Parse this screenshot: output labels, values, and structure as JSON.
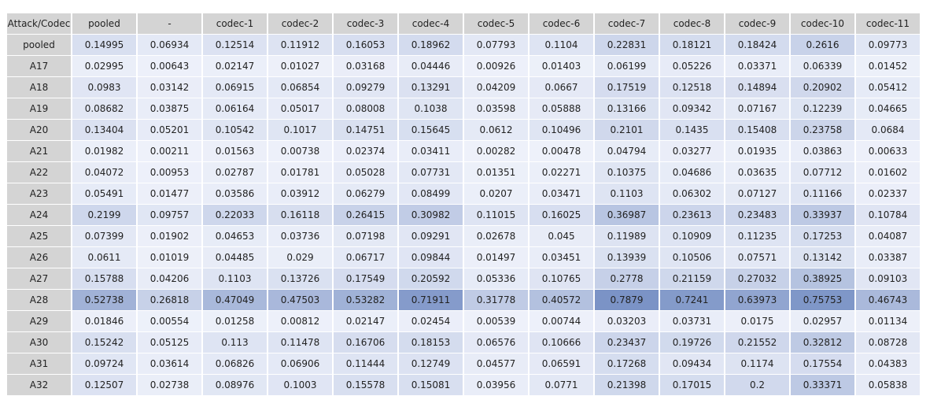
{
  "chart_data": {
    "type": "heatmap",
    "corner_label": "Attack/Codec",
    "columns": [
      "pooled",
      "-",
      "codec-1",
      "codec-2",
      "codec-3",
      "codec-4",
      "codec-5",
      "codec-6",
      "codec-7",
      "codec-8",
      "codec-9",
      "codec-10",
      "codec-11"
    ],
    "rows": [
      "pooled",
      "A17",
      "A18",
      "A19",
      "A20",
      "A21",
      "A22",
      "A23",
      "A24",
      "A25",
      "A26",
      "A27",
      "A28",
      "A29",
      "A30",
      "A31",
      "A32"
    ],
    "values": [
      [
        "0.14995",
        "0.06934",
        "0.12514",
        "0.11912",
        "0.16053",
        "0.18962",
        "0.07793",
        "0.1104",
        "0.22831",
        "0.18121",
        "0.18424",
        "0.2616",
        "0.09773"
      ],
      [
        "0.02995",
        "0.00643",
        "0.02147",
        "0.01027",
        "0.03168",
        "0.04446",
        "0.00926",
        "0.01403",
        "0.06199",
        "0.05226",
        "0.03371",
        "0.06339",
        "0.01452"
      ],
      [
        "0.0983",
        "0.03142",
        "0.06915",
        "0.06854",
        "0.09279",
        "0.13291",
        "0.04209",
        "0.0667",
        "0.17519",
        "0.12518",
        "0.14894",
        "0.20902",
        "0.05412"
      ],
      [
        "0.08682",
        "0.03875",
        "0.06164",
        "0.05017",
        "0.08008",
        "0.1038",
        "0.03598",
        "0.05888",
        "0.13166",
        "0.09342",
        "0.07167",
        "0.12239",
        "0.04665"
      ],
      [
        "0.13404",
        "0.05201",
        "0.10542",
        "0.1017",
        "0.14751",
        "0.15645",
        "0.0612",
        "0.10496",
        "0.2101",
        "0.1435",
        "0.15408",
        "0.23758",
        "0.0684"
      ],
      [
        "0.01982",
        "0.00211",
        "0.01563",
        "0.00738",
        "0.02374",
        "0.03411",
        "0.00282",
        "0.00478",
        "0.04794",
        "0.03277",
        "0.01935",
        "0.03863",
        "0.00633"
      ],
      [
        "0.04072",
        "0.00953",
        "0.02787",
        "0.01781",
        "0.05028",
        "0.07731",
        "0.01351",
        "0.02271",
        "0.10375",
        "0.04686",
        "0.03635",
        "0.07712",
        "0.01602"
      ],
      [
        "0.05491",
        "0.01477",
        "0.03586",
        "0.03912",
        "0.06279",
        "0.08499",
        "0.0207",
        "0.03471",
        "0.1103",
        "0.06302",
        "0.07127",
        "0.11166",
        "0.02337"
      ],
      [
        "0.2199",
        "0.09757",
        "0.22033",
        "0.16118",
        "0.26415",
        "0.30982",
        "0.11015",
        "0.16025",
        "0.36987",
        "0.23613",
        "0.23483",
        "0.33937",
        "0.10784"
      ],
      [
        "0.07399",
        "0.01902",
        "0.04653",
        "0.03736",
        "0.07198",
        "0.09291",
        "0.02678",
        "0.045",
        "0.11989",
        "0.10909",
        "0.11235",
        "0.17253",
        "0.04087"
      ],
      [
        "0.0611",
        "0.01019",
        "0.04485",
        "0.029",
        "0.06717",
        "0.09844",
        "0.01497",
        "0.03451",
        "0.13939",
        "0.10506",
        "0.07571",
        "0.13142",
        "0.03387"
      ],
      [
        "0.15788",
        "0.04206",
        "0.1103",
        "0.13726",
        "0.17549",
        "0.20592",
        "0.05336",
        "0.10765",
        "0.2778",
        "0.21159",
        "0.27032",
        "0.38925",
        "0.09103"
      ],
      [
        "0.52738",
        "0.26818",
        "0.47049",
        "0.47503",
        "0.53282",
        "0.71911",
        "0.31778",
        "0.40572",
        "0.7879",
        "0.7241",
        "0.63973",
        "0.75753",
        "0.46743"
      ],
      [
        "0.01846",
        "0.00554",
        "0.01258",
        "0.00812",
        "0.02147",
        "0.02454",
        "0.00539",
        "0.00744",
        "0.03203",
        "0.03731",
        "0.0175",
        "0.02957",
        "0.01134"
      ],
      [
        "0.15242",
        "0.05125",
        "0.113",
        "0.11478",
        "0.16706",
        "0.18153",
        "0.06576",
        "0.10666",
        "0.23437",
        "0.19726",
        "0.21552",
        "0.32812",
        "0.08728"
      ],
      [
        "0.09724",
        "0.03614",
        "0.06826",
        "0.06906",
        "0.11444",
        "0.12749",
        "0.04577",
        "0.06591",
        "0.17268",
        "0.09434",
        "0.1174",
        "0.17554",
        "0.04383"
      ],
      [
        "0.12507",
        "0.02738",
        "0.08976",
        "0.1003",
        "0.15578",
        "0.15081",
        "0.03956",
        "0.0771",
        "0.21398",
        "0.17015",
        "0.2",
        "0.33371",
        "0.05838"
      ]
    ],
    "color_scale": {
      "low": "#eef1fa",
      "high": "#7b93c6"
    }
  }
}
